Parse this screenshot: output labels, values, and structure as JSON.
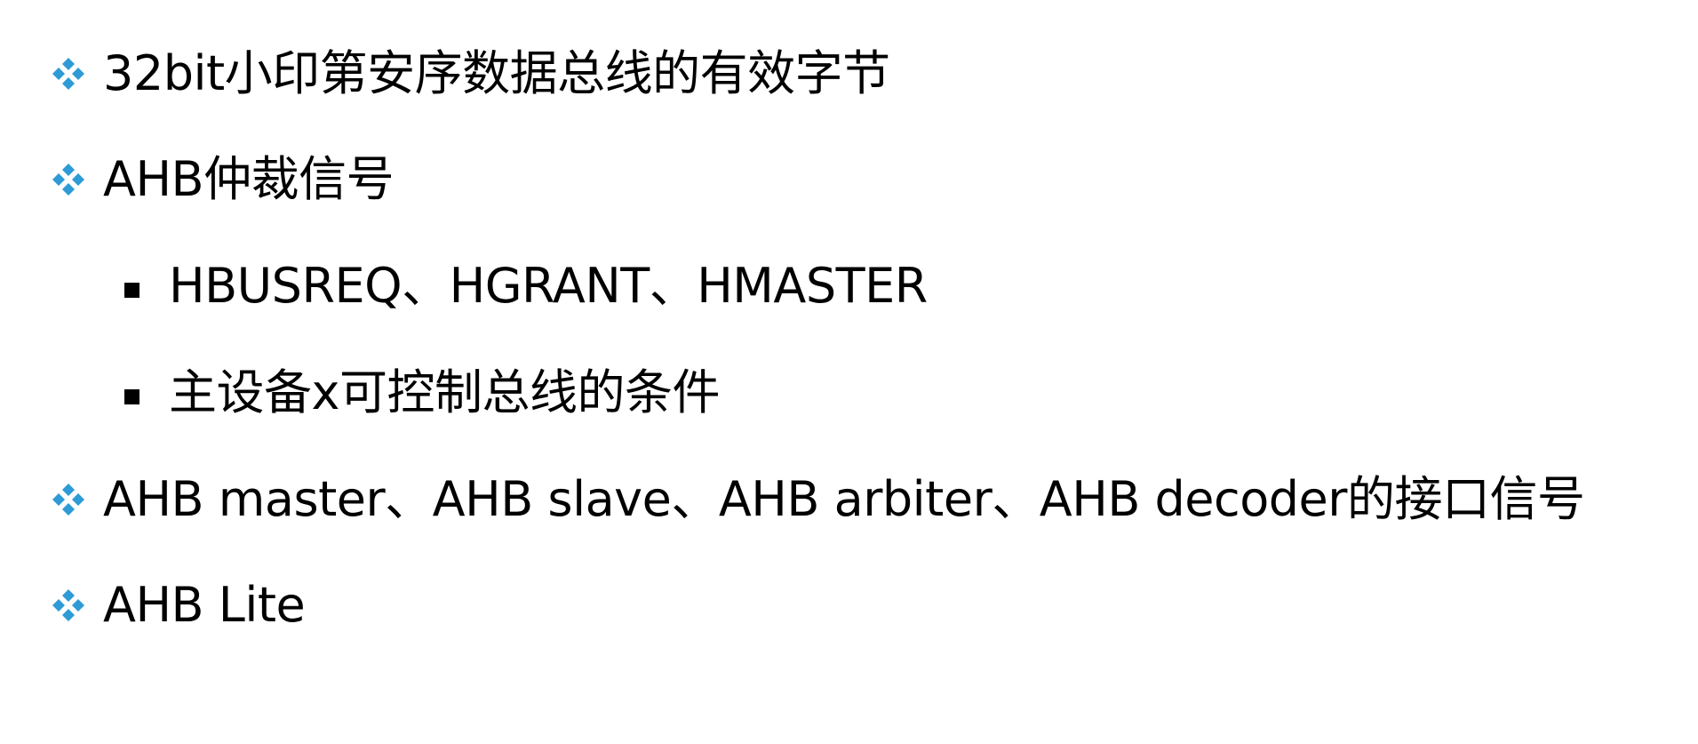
{
  "colors": {
    "bullet_accent": "#2E9BD6",
    "text": "#000000"
  },
  "icons": {
    "level1": "four-diamond-bullet-icon",
    "level2": "square-bullet-icon"
  },
  "bullets": [
    {
      "level": 1,
      "text": "32bit小印第安序数据总线的有效字节"
    },
    {
      "level": 1,
      "text": "AHB仲裁信号"
    },
    {
      "level": 2,
      "text": "HBUSREQ、HGRANT、HMASTER"
    },
    {
      "level": 2,
      "text": "主设备x可控制总线的条件"
    },
    {
      "level": 1,
      "text": "AHB master、AHB slave、AHB arbiter、AHB decoder的接口信号"
    },
    {
      "level": 1,
      "text": "AHB Lite"
    }
  ]
}
